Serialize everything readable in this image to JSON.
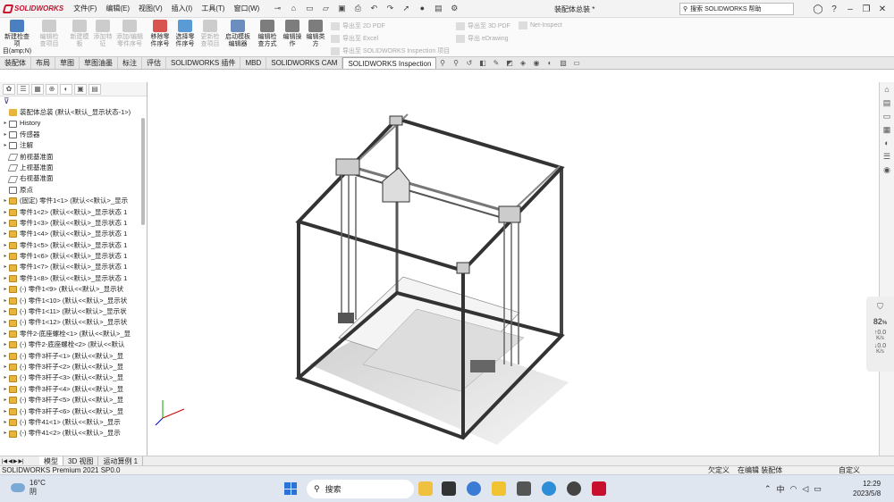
{
  "app": {
    "logo_text": "SOLIDWORKS",
    "doc_title": "装配体总装 *",
    "brand_color": "#c8102e"
  },
  "menu": [
    "文件(F)",
    "编辑(E)",
    "视图(V)",
    "插入(I)",
    "工具(T)",
    "窗口(W)"
  ],
  "search": {
    "placeholder": "搜索 SOLIDWORKS 帮助"
  },
  "ribbon": {
    "buttons": [
      {
        "label": "新建检查项\n目(amp;N)",
        "enabled": true
      },
      {
        "label": "编辑检\n查项目",
        "enabled": false
      },
      {
        "label": "新建模\n板",
        "enabled": false
      },
      {
        "label": "添加特\n征",
        "enabled": false
      },
      {
        "label": "添加/编辑\n零件序号",
        "enabled": false
      },
      {
        "label": "移除零\n件序号",
        "enabled": true
      },
      {
        "label": "选择零\n件序号",
        "enabled": true
      },
      {
        "label": "更新检\n查项目",
        "enabled": false
      },
      {
        "label": "启动模板\n编辑器",
        "enabled": true
      },
      {
        "label": "编辑检\n查方式",
        "enabled": true
      },
      {
        "label": "编辑操\n作",
        "enabled": true
      },
      {
        "label": "编辑类\n方",
        "enabled": true
      }
    ],
    "exports": [
      "导出至 2D PDF",
      "导出至 Excel",
      "导出至 SOLIDWORKS Inspection 项目",
      "导出至 3D PDF",
      "导出 eDrawing",
      "Net-Inspect"
    ]
  },
  "tabs": [
    "装配体",
    "布局",
    "草图",
    "草图油墨",
    "标注",
    "评估",
    "SOLIDWORKS 插件",
    "MBD",
    "SOLIDWORKS CAM",
    "SOLIDWORKS Inspection"
  ],
  "active_tab": "SOLIDWORKS Inspection",
  "tree": {
    "root": "装配体总装 (默认<默认_显示状态-1>)",
    "items": [
      {
        "label": "History",
        "icon": "history-folder-icon"
      },
      {
        "label": "传感器",
        "icon": "sensor-folder-icon"
      },
      {
        "label": "注解",
        "icon": "annotation-folder-icon"
      },
      {
        "label": "前视基准面",
        "icon": "plane-icon"
      },
      {
        "label": "上视基准面",
        "icon": "plane-icon"
      },
      {
        "label": "右视基准面",
        "icon": "plane-icon"
      },
      {
        "label": "原点",
        "icon": "origin-icon"
      },
      {
        "label": "(固定) 零件1<1> (默认<<默认>_显示",
        "icon": "part-icon"
      },
      {
        "label": "零件1<2> (默认<<默认>_显示状态 1",
        "icon": "part-icon"
      },
      {
        "label": "零件1<3> (默认<<默认>_显示状态 1",
        "icon": "part-icon"
      },
      {
        "label": "零件1<4> (默认<<默认>_显示状态 1",
        "icon": "part-icon"
      },
      {
        "label": "零件1<5> (默认<<默认>_显示状态 1",
        "icon": "part-icon"
      },
      {
        "label": "零件1<6> (默认<<默认>_显示状态 1",
        "icon": "part-icon"
      },
      {
        "label": "零件1<7> (默认<<默认>_显示状态 1",
        "icon": "part-icon"
      },
      {
        "label": "零件1<8> (默认<<默认>_显示状态 1",
        "icon": "part-icon"
      },
      {
        "label": "(-) 零件1<9> (默认<<默认>_显示状",
        "icon": "part-icon"
      },
      {
        "label": "(-) 零件1<10> (默认<<默认>_显示状",
        "icon": "part-icon"
      },
      {
        "label": "(-) 零件1<11> (默认<<默认>_显示状",
        "icon": "part-icon"
      },
      {
        "label": "(-) 零件1<12> (默认<<默认>_显示状",
        "icon": "part-icon"
      },
      {
        "label": "零件2-底座螺栓<1> (默认<<默认>_显",
        "icon": "part-icon"
      },
      {
        "label": "(-) 零件2-底座螺栓<2> (默认<<默认",
        "icon": "part-icon"
      },
      {
        "label": "(-) 零件3杆子<1> (默认<<默认>_显",
        "icon": "part-icon"
      },
      {
        "label": "(-) 零件3杆子<2> (默认<<默认>_显",
        "icon": "part-icon"
      },
      {
        "label": "(-) 零件3杆子<3> (默认<<默认>_显",
        "icon": "part-icon"
      },
      {
        "label": "(-) 零件3杆子<4> (默认<<默认>_显",
        "icon": "part-icon"
      },
      {
        "label": "(-) 零件3杆子<5> (默认<<默认>_显",
        "icon": "part-icon"
      },
      {
        "label": "(-) 零件3杆子<6> (默认<<默认>_显",
        "icon": "part-icon"
      },
      {
        "label": "(-) 零件41<1> (默认<<默认>_显示",
        "icon": "part-icon"
      },
      {
        "label": "(-) 零件41<2> (默认<<默认>_显示",
        "icon": "part-icon"
      }
    ]
  },
  "bottom_tabs": [
    "模型",
    "3D 视图",
    "运动算例 1"
  ],
  "status": {
    "version": "SOLIDWORKS Premium 2021 SP0.0",
    "under_defined": "欠定义",
    "editing": "在编辑 装配体",
    "custom": "自定义"
  },
  "netmon": {
    "percent": "82",
    "unit": "%",
    "up": "0.0",
    "down": "0.0",
    "speed_unit": "K/s"
  },
  "taskbar": {
    "temp": "16°C",
    "weather": "阴",
    "search": "搜索",
    "ime": "中",
    "time": "12:29",
    "date": "2023/5/8"
  }
}
